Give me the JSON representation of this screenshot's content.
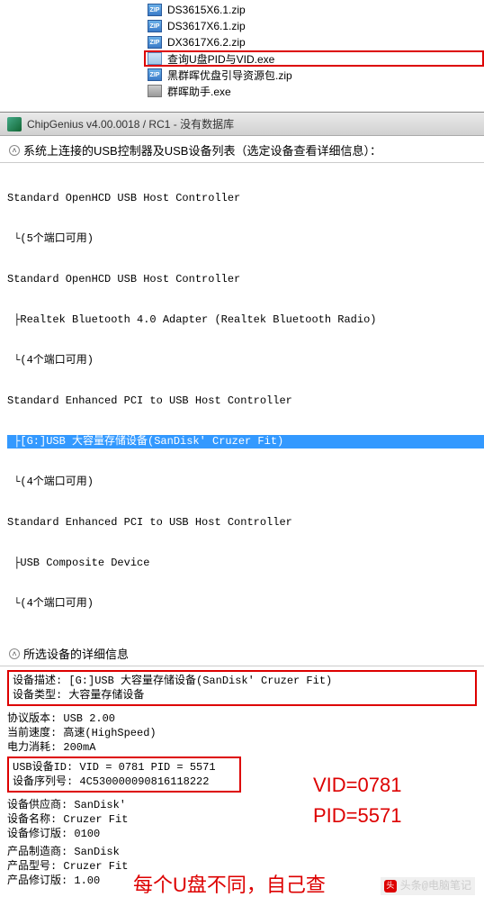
{
  "files": [
    {
      "icon": "zip",
      "name": "DS3615X6.1.zip"
    },
    {
      "icon": "zip",
      "name": "DS3617X6.1.zip"
    },
    {
      "icon": "zip",
      "name": "DX3617X6.2.zip"
    },
    {
      "icon": "exe-window",
      "name": "查询U盘PID与VID.exe",
      "highlighted": true
    },
    {
      "icon": "zip",
      "name": "黑群晖优盘引导资源包.zip"
    },
    {
      "icon": "exe-gray",
      "name": "群晖助手.exe"
    }
  ],
  "app": {
    "title": "ChipGenius v4.00.0018 / RC1 - 没有数据库"
  },
  "section1": {
    "label": "系统上连接的USB控制器及USB设备列表（选定设备查看详细信息）："
  },
  "tree": {
    "l0": "Standard OpenHCD USB Host Controller",
    "l1": " └(5个端口可用)",
    "l2": "Standard OpenHCD USB Host Controller",
    "l3": " ├Realtek Bluetooth 4.0 Adapter (Realtek Bluetooth Radio)",
    "l4": " └(4个端口可用)",
    "l5": "Standard Enhanced PCI to USB Host Controller",
    "l6": " ├[G:]USB 大容量存储设备(SanDisk' Cruzer Fit)",
    "l7": " └(4个端口可用)",
    "l8": "Standard Enhanced PCI to USB Host Controller",
    "l9": " ├USB Composite Device",
    "l10": " └(4个端口可用)"
  },
  "section2": {
    "label": "所选设备的详细信息"
  },
  "details": {
    "d0": "设备描述: [G:]USB 大容量存储设备(SanDisk' Cruzer Fit)",
    "d1": "设备类型: 大容量存储设备",
    "d2": "协议版本: USB 2.00",
    "d3": "当前速度: 高速(HighSpeed)",
    "d4": "电力消耗: 200mA",
    "d5": "USB设备ID: VID = 0781 PID = 5571",
    "d6": "设备序列号: 4C530000090816118222",
    "d7": "设备供应商: SanDisk'",
    "d8": "设备名称: Cruzer Fit",
    "d9": "设备修订版: 0100",
    "d10": "产品制造商: SanDisk",
    "d11": "产品型号: Cruzer Fit",
    "d12": "产品修订版: 1.00"
  },
  "annotations": {
    "vid": "VID=0781",
    "pid": "PID=5571",
    "note": "每个U盘不同，自己查"
  },
  "watermark": {
    "text": "头条@电脑笔记"
  }
}
